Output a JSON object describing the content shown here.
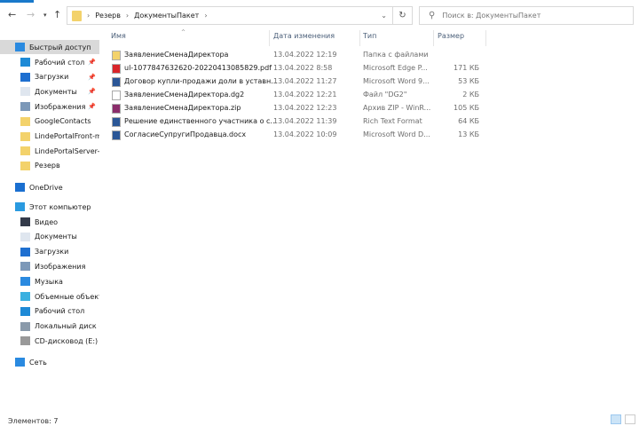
{
  "address": {
    "crumbs": [
      "Резерв",
      "ДокументыПакет"
    ]
  },
  "search": {
    "placeholder": "Поиск в: ДокументыПакет"
  },
  "columns": {
    "name": "Имя",
    "date": "Дата изменения",
    "type": "Тип",
    "size": "Размер"
  },
  "sidebar": {
    "quick_access": "Быстрый доступ",
    "quick": [
      {
        "label": "Рабочий стол",
        "icon": "desktop-icon",
        "pinned": true
      },
      {
        "label": "Загрузки",
        "icon": "downloads-icon",
        "pinned": true
      },
      {
        "label": "Документы",
        "icon": "documents-icon",
        "pinned": true
      },
      {
        "label": "Изображения",
        "icon": "pictures-icon",
        "pinned": true
      },
      {
        "label": "GoogleContacts",
        "icon": "folder-icon"
      },
      {
        "label": "LindePortalFront-m",
        "icon": "folder-icon"
      },
      {
        "label": "LindePortalServer-n",
        "icon": "folder-icon"
      },
      {
        "label": "Резерв",
        "icon": "folder-icon"
      }
    ],
    "onedrive": "OneDrive",
    "this_pc": "Этот компьютер",
    "pc": [
      {
        "label": "Видео",
        "icon": "video-icon"
      },
      {
        "label": "Документы",
        "icon": "documents-icon"
      },
      {
        "label": "Загрузки",
        "icon": "downloads-icon"
      },
      {
        "label": "Изображения",
        "icon": "pictures-icon"
      },
      {
        "label": "Музыка",
        "icon": "music-icon"
      },
      {
        "label": "Объемные объекты",
        "icon": "3d-objects-icon"
      },
      {
        "label": "Рабочий стол",
        "icon": "desktop-icon"
      },
      {
        "label": "Локальный диск (C",
        "icon": "disk-icon"
      },
      {
        "label": "CD-дисковод (E:)",
        "icon": "cd-icon"
      }
    ],
    "network": "Сеть"
  },
  "files": [
    {
      "name": "ЗаявлениеСменаДиректора",
      "date": "13.04.2022 12:19",
      "type": "Папка с файлами",
      "size": "",
      "icon": "folder-icon",
      "color": "#f3d26b"
    },
    {
      "name": "ul-1077847632620-20220413085829.pdf",
      "date": "13.04.2022 8:58",
      "type": "Microsoft Edge P...",
      "size": "171 КБ",
      "icon": "pdf-icon",
      "color": "#d9252a"
    },
    {
      "name": "Договор купли-продажи доли в уставн...",
      "date": "13.04.2022 11:27",
      "type": "Microsoft Word 9...",
      "size": "53 КБ",
      "icon": "word-icon",
      "color": "#2b5797"
    },
    {
      "name": "ЗаявлениеСменаДиректора.dg2",
      "date": "13.04.2022 12:21",
      "type": "Файл \"DG2\"",
      "size": "2 КБ",
      "icon": "file-icon",
      "color": "#ffffff"
    },
    {
      "name": "ЗаявлениеСменаДиректора.zip",
      "date": "13.04.2022 12:23",
      "type": "Архив ZIP - WinR...",
      "size": "105 КБ",
      "icon": "winrar-icon",
      "color": "#8b2d6b"
    },
    {
      "name": "Решение единственного участника о с...",
      "date": "13.04.2022 11:39",
      "type": "Rich Text Format",
      "size": "64 КБ",
      "icon": "rtf-icon",
      "color": "#2b5797"
    },
    {
      "name": "СогласиеСупругиПродавца.docx",
      "date": "13.04.2022 10:09",
      "type": "Microsoft Word D...",
      "size": "13 КБ",
      "icon": "word-icon",
      "color": "#2b5797"
    }
  ],
  "status": {
    "count": "Элементов: 7"
  }
}
